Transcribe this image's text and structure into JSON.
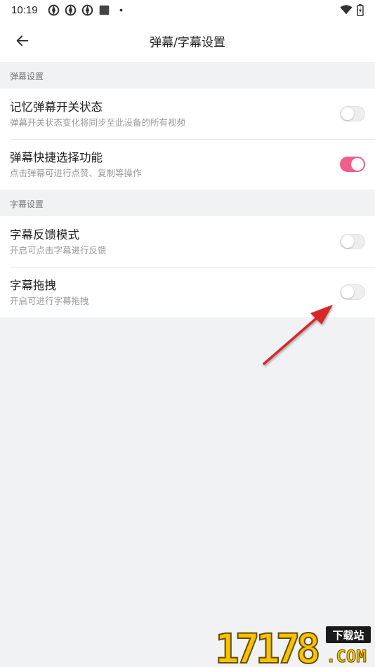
{
  "status_bar": {
    "time": "10:19",
    "icons": [
      "app-notification-icon",
      "app-notification-icon",
      "app-notification-icon",
      "square-notification-icon",
      "dot-icon"
    ],
    "right_icons": [
      "wifi-icon",
      "battery-icon"
    ]
  },
  "header": {
    "title": "弹幕/字幕设置",
    "back_icon": "arrow-left-icon"
  },
  "sections": [
    {
      "title": "弹幕设置",
      "items": [
        {
          "title": "记忆弹幕开关状态",
          "subtitle": "弹幕开关状态变化将同步至此设备的所有视频",
          "enabled": false
        },
        {
          "title": "弹幕快捷选择功能",
          "subtitle": "点击弹幕可进行点赞、复制等操作",
          "enabled": true
        }
      ]
    },
    {
      "title": "字幕设置",
      "items": [
        {
          "title": "字幕反馈模式",
          "subtitle": "开启可点击字幕进行反馈",
          "enabled": false
        },
        {
          "title": "字幕拖拽",
          "subtitle": "开启可进行字幕拖拽",
          "enabled": false
        }
      ]
    }
  ],
  "colors": {
    "accent": "#f25d8e",
    "background": "#f1f2f4",
    "annotation_arrow": "#d9262b"
  },
  "watermark": {
    "digits": "17178",
    "badge": "下载站",
    "suffix": ".COM"
  }
}
